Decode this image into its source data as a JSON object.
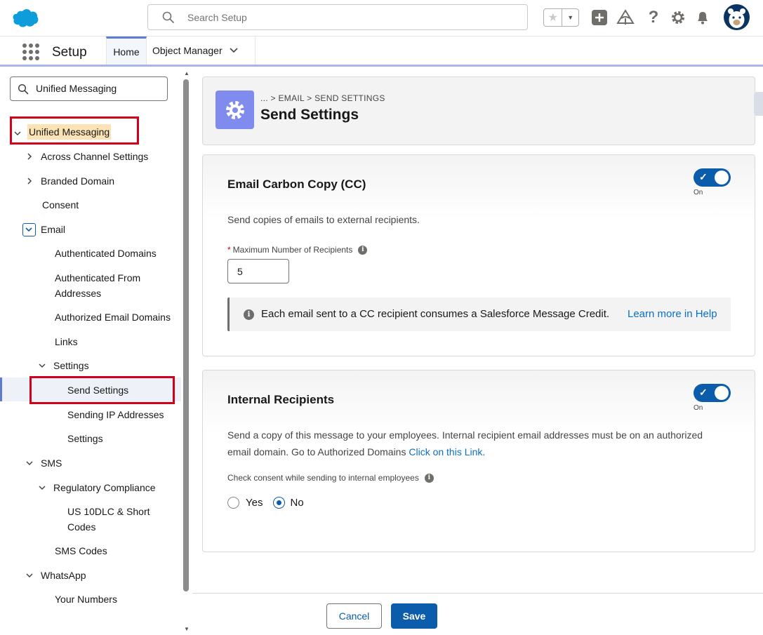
{
  "header": {
    "search_placeholder": "Search Setup"
  },
  "nav": {
    "app_name": "Setup",
    "tabs": [
      {
        "label": "Home"
      },
      {
        "label": "Object Manager"
      }
    ]
  },
  "sidebar": {
    "quickfind_value": "Unified Messaging",
    "items": [
      {
        "label": "Unified Messaging"
      },
      {
        "label": "Across Channel Settings"
      },
      {
        "label": "Branded Domain"
      },
      {
        "label": "Consent"
      },
      {
        "label": "Email"
      },
      {
        "label": "Authenticated Domains"
      },
      {
        "label": "Authenticated From"
      },
      {
        "label": "Addresses"
      },
      {
        "label": "Authorized Email Domains"
      },
      {
        "label": "Links"
      },
      {
        "label": "Settings"
      },
      {
        "label": "Send Settings"
      },
      {
        "label": "Sending IP Addresses"
      },
      {
        "label": "Settings"
      },
      {
        "label": "SMS"
      },
      {
        "label": "Regulatory Compliance"
      },
      {
        "label": "US 10DLC & Short"
      },
      {
        "label": "Codes"
      },
      {
        "label": "SMS Codes"
      },
      {
        "label": "WhatsApp"
      },
      {
        "label": "Your Numbers"
      }
    ]
  },
  "page": {
    "breadcrumb": "... > EMAIL > SEND SETTINGS",
    "title": "Send Settings"
  },
  "cc_card": {
    "title": "Email Carbon Copy (CC)",
    "toggle_state": "On",
    "description": "Send copies of emails to external recipients.",
    "field_label": "Maximum Number of Recipients",
    "field_value": "5",
    "notice_text": "Each email sent to a CC recipient consumes a Salesforce Message Credit.",
    "notice_link": "Learn more in Help"
  },
  "internal_card": {
    "title": "Internal Recipients",
    "toggle_state": "On",
    "description_line1": "Send a copy of this message to your employees. Internal recipient email addresses must be on an authorized",
    "description_line2": "email domain. Go to Authorized Domains",
    "description_link": "Click on this Link.",
    "consent_label": "Check consent while sending to internal employees",
    "radio_yes": "Yes",
    "radio_no": "No",
    "selected": "No"
  },
  "footer": {
    "cancel_label": "Cancel",
    "save_label": "Save"
  },
  "colors": {
    "brand_blue": "#0b5cab",
    "accent_tab": "#5d7cd0",
    "highlight_red": "#d0021b",
    "search_highlight": "#fbe3b5"
  },
  "icons": [
    "salesforce-cloud-icon",
    "search-icon",
    "star-icon",
    "add-icon",
    "trailhead-icon",
    "help-icon",
    "gear-icon",
    "bell-icon",
    "avatar",
    "waffle-icon",
    "chevron-down-icon",
    "chevron-right-icon",
    "info-icon"
  ]
}
